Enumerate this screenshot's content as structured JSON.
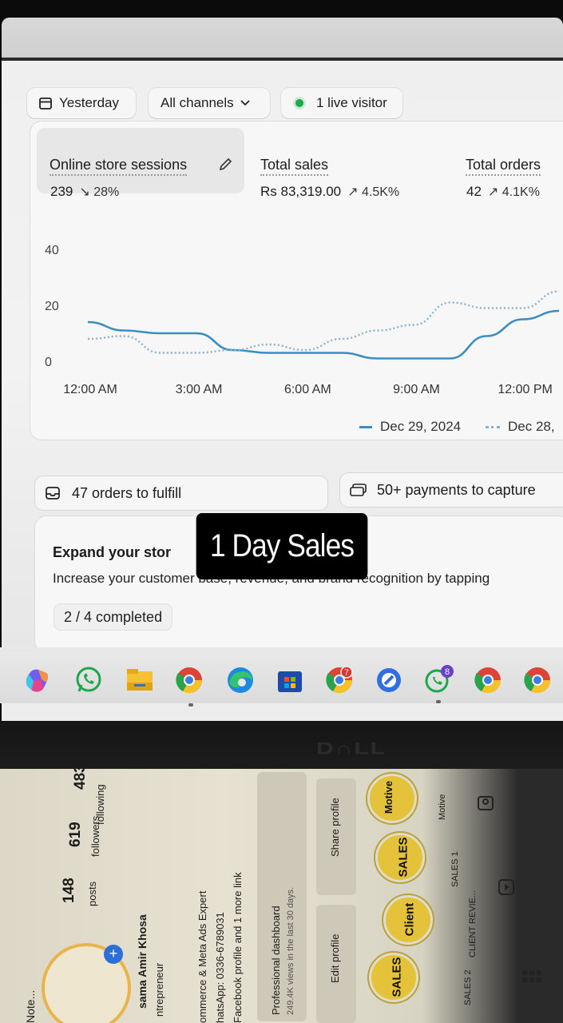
{
  "filters": {
    "date_label": "Yesterday",
    "channel_label": "All channels",
    "live_label": "1 live visitor"
  },
  "metrics": [
    {
      "label": "Online store sessions",
      "value": "239",
      "change": "28%",
      "direction": "down"
    },
    {
      "label": "Total sales",
      "value": "Rs 83,319.00",
      "change": "4.5K%",
      "direction": "up"
    },
    {
      "label": "Total orders",
      "value": "42",
      "change": "4.1K%",
      "direction": "up"
    }
  ],
  "chart_data": {
    "type": "line",
    "x": [
      "12:00 AM",
      "1:00 AM",
      "2:00 AM",
      "3:00 AM",
      "4:00 AM",
      "5:00 AM",
      "6:00 AM",
      "7:00 AM",
      "8:00 AM",
      "9:00 AM",
      "10:00 AM",
      "11:00 AM",
      "12:00 PM",
      "1:00 PM"
    ],
    "x_tick_labels": [
      "12:00 AM",
      "3:00 AM",
      "6:00 AM",
      "9:00 AM",
      "12:00 PM"
    ],
    "y_tick_labels": [
      "40",
      "20",
      "0"
    ],
    "ylim": [
      0,
      40
    ],
    "series": [
      {
        "name": "Dec 29, 2024",
        "style": "solid",
        "color": "#3b8fc0",
        "values": [
          14,
          11,
          10,
          10,
          4,
          3,
          3,
          3,
          1,
          1,
          1,
          9,
          15,
          18
        ]
      },
      {
        "name": "Dec 28,",
        "style": "dotted",
        "color": "#86b3d3",
        "values": [
          8,
          9,
          3,
          3,
          4,
          6,
          4,
          8,
          11,
          13,
          21,
          19,
          19,
          25
        ]
      }
    ]
  },
  "tasks": {
    "fulfill_label": "47 orders to fulfill",
    "capture_label": "50+ payments to capture"
  },
  "expand": {
    "title": "Expand your stor",
    "text": "Increase your customer base, revenue, and brand recognition by tapping",
    "progress": "2 / 4 completed"
  },
  "overlay_caption": "1 Day Sales",
  "taskbar_badges": {
    "chrome_profile": "7",
    "whatsapp": "8"
  },
  "profile": {
    "posts": "148",
    "posts_label": "posts",
    "followers": "619",
    "followers_label": "followers",
    "following": "483",
    "following_label": "following",
    "name": "sama Amir Khosa",
    "category": "ntrepreneur",
    "bio_line": "ommerce & Meta Ads Expert",
    "whatsapp": "hatsApp: 0336-6789031",
    "link": "Facebook profile and 1 more link",
    "dashboard_title": "Professional dashboard",
    "dashboard_sub": "249.4K views in the last 30 days.",
    "edit_profile": "Edit profile",
    "share_profile": "Share profile",
    "note": "Note...",
    "highlights": [
      {
        "title": "SALES 2",
        "badge": "SALES"
      },
      {
        "title": "CLIENT REVIE...",
        "badge": "Client"
      },
      {
        "title": "SALES 1",
        "badge": "SALES"
      },
      {
        "title": "Motive",
        "badge": "Motive"
      }
    ]
  }
}
